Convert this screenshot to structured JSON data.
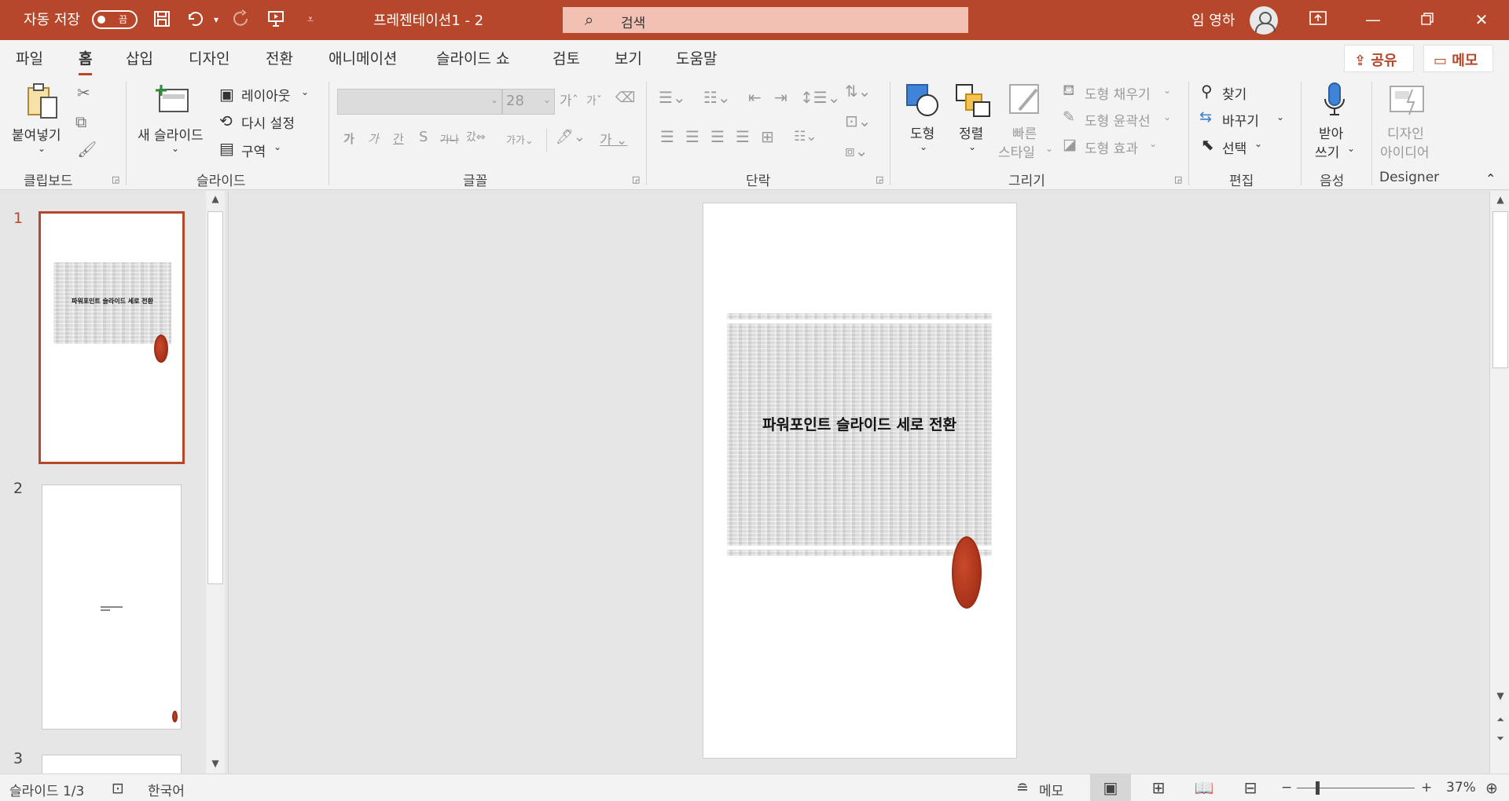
{
  "titlebar": {
    "autosave_label": "자동 저장",
    "autosave_state": "끔",
    "doc_title": "프레젠테이션1 - 2",
    "search_placeholder": "검색",
    "user_name": "임 영하",
    "accent_color": "#b7472a"
  },
  "tabs": [
    "파일",
    "홈",
    "삽입",
    "디자인",
    "전환",
    "애니메이션",
    "슬라이드 쇼",
    "검토",
    "보기",
    "도움말"
  ],
  "active_tab": "홈",
  "share_label": "공유",
  "memo_label": "메모",
  "ribbon": {
    "clipboard": {
      "paste": "붙여넣기",
      "group": "클립보드"
    },
    "slides": {
      "new_slide": "새 슬라이드",
      "layout": "레이아웃",
      "reset": "다시 설정",
      "section": "구역",
      "group": "슬라이드"
    },
    "font": {
      "size": "28",
      "group": "글꼴"
    },
    "paragraph": {
      "group": "단락"
    },
    "drawing": {
      "shapes": "도형",
      "arrange": "정렬",
      "quick_styles_1": "빠른",
      "quick_styles_2": "스타일",
      "fill": "도형 채우기",
      "outline": "도형 윤곽선",
      "effects": "도형 효과",
      "group": "그리기"
    },
    "editing": {
      "find": "찾기",
      "replace": "바꾸기",
      "select": "선택",
      "group": "편집"
    },
    "voice": {
      "dictate_1": "받아",
      "dictate_2": "쓰기",
      "group": "음성"
    },
    "designer": {
      "ideas_1": "디자인",
      "ideas_2": "아이디어",
      "group": "Designer"
    }
  },
  "thumbnails": [
    {
      "num": "1",
      "title": "파워포인트 슬라이드 세로 전환",
      "active": true
    },
    {
      "num": "2",
      "active": false
    },
    {
      "num": "3",
      "active": false
    }
  ],
  "slide": {
    "title": "파워포인트 슬라이드 세로 전환"
  },
  "status": {
    "slide_info": "슬라이드 1/3",
    "language": "한국어",
    "notes": "메모",
    "zoom": "37%"
  }
}
